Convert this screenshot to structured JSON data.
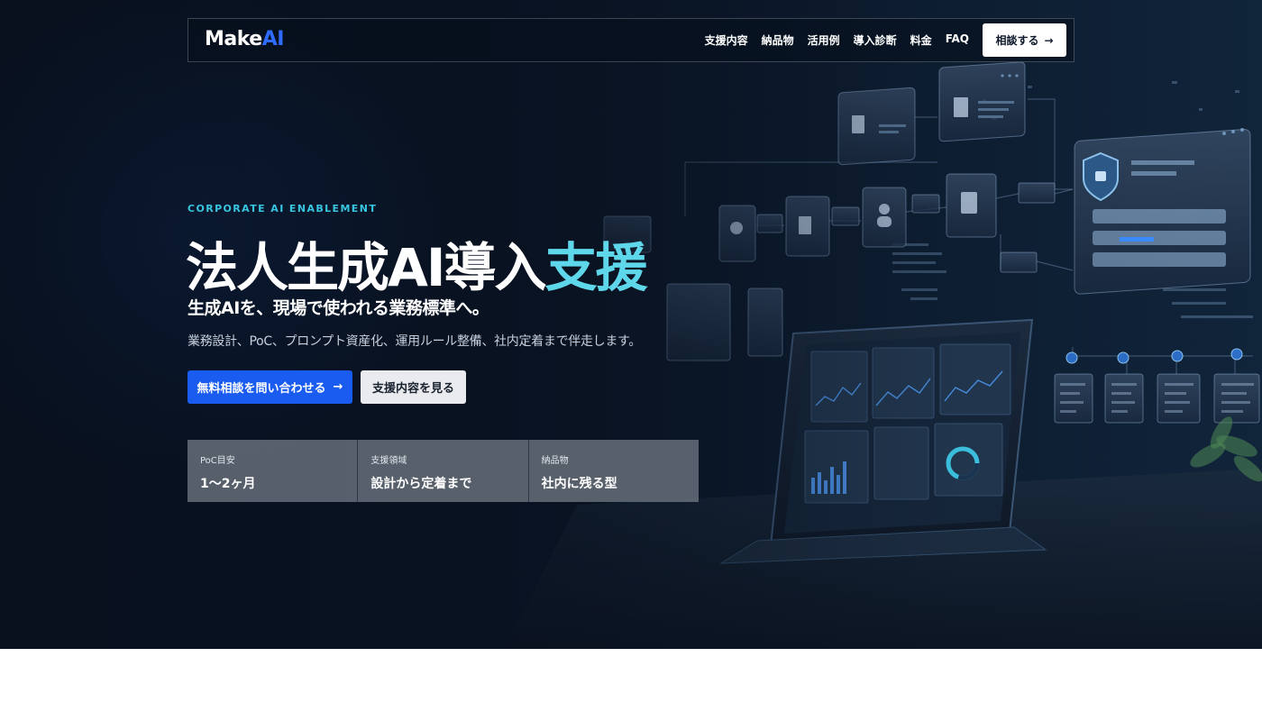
{
  "brand": {
    "logo_prefix": "Make",
    "logo_accent": "AI"
  },
  "nav": {
    "items": [
      "支援内容",
      "納品物",
      "活用例",
      "導入診断",
      "料金",
      "FAQ"
    ],
    "cta_label": "相談する",
    "cta_icon": "arrow-right-icon"
  },
  "hero": {
    "eyebrow": "CORPORATE AI ENABLEMENT",
    "title_main": "法人生成AI導入",
    "title_accent": "支援",
    "subtitle": "生成AIを、現場で使われる業務標準へ。",
    "description": "業務設計、PoC、プロンプト資産化、運用ルール整備、社内定着まで伴走します。",
    "primary_cta": "無料相談を問い合わせる",
    "secondary_cta": "支援内容を見る"
  },
  "stats": [
    {
      "label": "PoC目安",
      "value": "1〜2ヶ月"
    },
    {
      "label": "支援領域",
      "value": "設計から定着まで"
    },
    {
      "label": "納品物",
      "value": "社内に残る型"
    }
  ],
  "colors": {
    "accent_blue": "#1a5cf0",
    "accent_cyan": "#5fd7ea",
    "eyebrow": "#38c6e0",
    "hero_bg": "#0a1627"
  }
}
